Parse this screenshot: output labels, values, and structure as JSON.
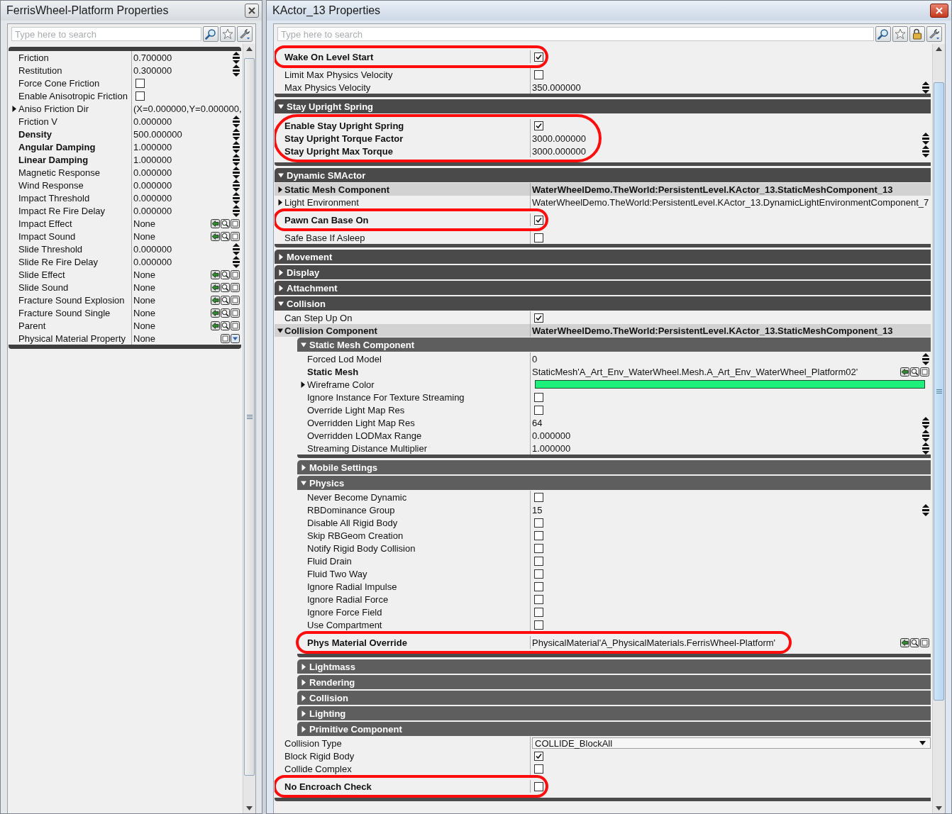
{
  "left": {
    "title": "FerrisWheel-Platform Properties",
    "active": false,
    "search": {
      "placeholder": "Type here to search"
    },
    "tools": [
      {
        "kind": "search"
      },
      {
        "kind": "favorites"
      },
      {
        "kind": "options"
      }
    ],
    "rows": [
      {
        "label": "Friction",
        "bold": false,
        "kind": "number",
        "value": "0.700000"
      },
      {
        "label": "Restitution",
        "bold": false,
        "kind": "number",
        "value": "0.300000"
      },
      {
        "label": "Force Cone Friction",
        "bold": false,
        "kind": "checkbox",
        "checked": false
      },
      {
        "label": "Enable Anisotropic Friction",
        "bold": false,
        "kind": "checkbox",
        "checked": false
      },
      {
        "label": "Aniso Friction Dir",
        "bold": false,
        "kind": "text",
        "value": "(X=0.000000,Y=0.000000,",
        "expanded": false
      },
      {
        "label": "Friction V",
        "bold": false,
        "kind": "number",
        "value": "0.000000"
      },
      {
        "label": "Density",
        "bold": true,
        "kind": "number",
        "value": "500.000000"
      },
      {
        "label": "Angular Damping",
        "bold": true,
        "kind": "number",
        "value": "1.000000"
      },
      {
        "label": "Linear Damping",
        "bold": true,
        "kind": "number",
        "value": "1.000000"
      },
      {
        "label": "Magnetic Response",
        "bold": false,
        "kind": "number",
        "value": "0.000000"
      },
      {
        "label": "Wind Response",
        "bold": false,
        "kind": "number",
        "value": "0.000000"
      },
      {
        "label": "Impact Threshold",
        "bold": false,
        "kind": "number",
        "value": "0.000000"
      },
      {
        "label": "Impact Re Fire Delay",
        "bold": false,
        "kind": "number",
        "value": "0.000000"
      },
      {
        "label": "Impact Effect",
        "bold": false,
        "kind": "asset",
        "value": "None"
      },
      {
        "label": "Impact Sound",
        "bold": false,
        "kind": "asset",
        "value": "None"
      },
      {
        "label": "Slide Threshold",
        "bold": false,
        "kind": "number",
        "value": "0.000000"
      },
      {
        "label": "Slide Re Fire Delay",
        "bold": false,
        "kind": "number",
        "value": "0.000000"
      },
      {
        "label": "Slide Effect",
        "bold": false,
        "kind": "asset",
        "value": "None"
      },
      {
        "label": "Slide Sound",
        "bold": false,
        "kind": "asset",
        "value": "None"
      },
      {
        "label": "Fracture Sound Explosion",
        "bold": false,
        "kind": "asset",
        "value": "None"
      },
      {
        "label": "Fracture Sound Single",
        "bold": false,
        "kind": "asset",
        "value": "None"
      },
      {
        "label": "Parent",
        "bold": false,
        "kind": "asset",
        "value": "None"
      },
      {
        "label": "Physical Material Property",
        "bold": false,
        "kind": "new_object",
        "value": "None"
      }
    ]
  },
  "right": {
    "title": "KActor_13 Properties",
    "active": true,
    "search": {
      "placeholder": "Type here to search"
    },
    "tools": [
      {
        "kind": "search"
      },
      {
        "kind": "favorites"
      },
      {
        "kind": "lock"
      },
      {
        "kind": "options"
      }
    ],
    "items": [
      {
        "kind": "category",
        "expanded": true,
        "children": [
          {
            "label": "Wake On Level Start",
            "bold": true,
            "kind": "checkbox",
            "checked": true,
            "circled": true
          },
          {
            "label": "Limit Max Physics Velocity",
            "bold": false,
            "kind": "checkbox",
            "checked": false
          },
          {
            "label": "Max Physics Velocity",
            "bold": false,
            "kind": "number",
            "value": "350.000000"
          }
        ]
      },
      {
        "kind": "category",
        "label": "Stay Upright Spring",
        "expanded": true,
        "children": [
          {
            "label": "Enable Stay Upright Spring",
            "bold": true,
            "kind": "checkbox",
            "checked": true,
            "circled": true
          },
          {
            "label": "Stay Upright Torque Factor",
            "bold": true,
            "kind": "number",
            "value": "3000.000000",
            "circled": true
          },
          {
            "label": "Stay Upright Max Torque",
            "bold": true,
            "kind": "number",
            "value": "3000.000000",
            "circled": true
          }
        ]
      },
      {
        "kind": "category",
        "label": "Dynamic SMActor",
        "expanded": true,
        "children": [
          {
            "label": "Static Mesh Component",
            "bold": true,
            "kind": "object",
            "value": "WaterWheelDemo.TheWorld:PersistentLevel.KActor_13.StaticMeshComponent_13",
            "expanded": false,
            "selected": true
          },
          {
            "label": "Light Environment",
            "bold": false,
            "kind": "object",
            "value": "WaterWheelDemo.TheWorld:PersistentLevel.KActor_13.DynamicLightEnvironmentComponent_7",
            "expanded": false,
            "selected": false
          },
          {
            "label": "Pawn Can Base On",
            "bold": true,
            "kind": "checkbox",
            "checked": true,
            "circled": true
          },
          {
            "label": "Safe Base If Asleep",
            "bold": false,
            "kind": "checkbox",
            "checked": false
          }
        ]
      },
      {
        "kind": "category",
        "label": "Movement",
        "expanded": false
      },
      {
        "kind": "category",
        "label": "Display",
        "expanded": false
      },
      {
        "kind": "category",
        "label": "Attachment",
        "expanded": false
      },
      {
        "kind": "category",
        "label": "Collision",
        "expanded": true,
        "children": [
          {
            "label": "Can Step Up On",
            "bold": false,
            "kind": "checkbox",
            "checked": true
          },
          {
            "label": "Collision Component",
            "bold": true,
            "kind": "object",
            "value": "WaterWheelDemo.TheWorld:PersistentLevel.KActor_13.StaticMeshComponent_13",
            "expanded": true,
            "selected": true,
            "children": [
              {
                "kind": "category",
                "label": "Static Mesh Component",
                "expanded": true,
                "children": [
                  {
                    "label": "Forced Lod Model",
                    "bold": false,
                    "kind": "number",
                    "value": "0"
                  },
                  {
                    "label": "Static Mesh",
                    "bold": true,
                    "kind": "asset",
                    "value": "StaticMesh'A_Art_Env_WaterWheel.Mesh.A_Art_Env_WaterWheel_Platform02'"
                  },
                  {
                    "label": "Wireframe Color",
                    "bold": false,
                    "kind": "color",
                    "color": "#1ef07c",
                    "expanded": false
                  },
                  {
                    "label": "Ignore Instance For Texture Streaming",
                    "bold": false,
                    "kind": "checkbox",
                    "checked": false
                  },
                  {
                    "label": "Override Light Map Res",
                    "bold": false,
                    "kind": "checkbox",
                    "checked": false
                  },
                  {
                    "label": "Overridden Light Map Res",
                    "bold": false,
                    "kind": "number",
                    "value": "64"
                  },
                  {
                    "label": "Overridden LODMax Range",
                    "bold": false,
                    "kind": "number",
                    "value": "0.000000"
                  },
                  {
                    "label": "Streaming Distance Multiplier",
                    "bold": false,
                    "kind": "number",
                    "value": "1.000000"
                  }
                ]
              },
              {
                "kind": "category",
                "label": "Mobile Settings",
                "expanded": false
              },
              {
                "kind": "category",
                "label": "Physics",
                "expanded": true,
                "children": [
                  {
                    "label": "Never Become Dynamic",
                    "bold": false,
                    "kind": "checkbox",
                    "checked": false
                  },
                  {
                    "label": "RBDominance Group",
                    "bold": false,
                    "kind": "number",
                    "value": "15"
                  },
                  {
                    "label": "Disable All Rigid Body",
                    "bold": false,
                    "kind": "checkbox",
                    "checked": false
                  },
                  {
                    "label": "Skip RBGeom Creation",
                    "bold": false,
                    "kind": "checkbox",
                    "checked": false
                  },
                  {
                    "label": "Notify Rigid Body Collision",
                    "bold": false,
                    "kind": "checkbox",
                    "checked": false
                  },
                  {
                    "label": "Fluid Drain",
                    "bold": false,
                    "kind": "checkbox",
                    "checked": false
                  },
                  {
                    "label": "Fluid Two Way",
                    "bold": false,
                    "kind": "checkbox",
                    "checked": false
                  },
                  {
                    "label": "Ignore Radial Impulse",
                    "bold": false,
                    "kind": "checkbox",
                    "checked": false
                  },
                  {
                    "label": "Ignore Radial Force",
                    "bold": false,
                    "kind": "checkbox",
                    "checked": false
                  },
                  {
                    "label": "Ignore Force Field",
                    "bold": false,
                    "kind": "checkbox",
                    "checked": false
                  },
                  {
                    "label": "Use Compartment",
                    "bold": false,
                    "kind": "checkbox",
                    "checked": false
                  },
                  {
                    "label": "Phys Material Override",
                    "bold": true,
                    "kind": "asset",
                    "value": "PhysicalMaterial'A_PhysicalMaterials.FerrisWheel-Platform'",
                    "circled": true
                  }
                ]
              },
              {
                "kind": "category",
                "label": "Lightmass",
                "expanded": false
              },
              {
                "kind": "category",
                "label": "Rendering",
                "expanded": false
              },
              {
                "kind": "category",
                "label": "Collision",
                "expanded": false
              },
              {
                "kind": "category",
                "label": "Lighting",
                "expanded": false
              },
              {
                "kind": "category",
                "label": "Primitive Component",
                "expanded": false
              }
            ]
          },
          {
            "label": "Collision Type",
            "bold": false,
            "kind": "dropdown",
            "value": "COLLIDE_BlockAll"
          },
          {
            "label": "Block Rigid Body",
            "bold": false,
            "kind": "checkbox",
            "checked": true
          },
          {
            "label": "Collide Complex",
            "bold": false,
            "kind": "checkbox",
            "checked": false
          },
          {
            "label": "No Encroach Check",
            "bold": true,
            "kind": "checkbox",
            "checked": false,
            "circled": true
          }
        ]
      }
    ]
  }
}
